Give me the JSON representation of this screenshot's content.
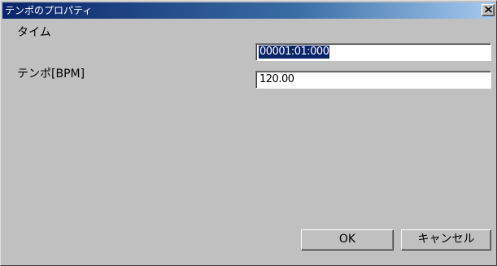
{
  "window": {
    "title": "テンポのプロパティ",
    "close_glyph": "×"
  },
  "fields": [
    {
      "label": "タイム",
      "value": "00001:01:000",
      "selected": true
    },
    {
      "label": "テンポ[BPM]",
      "value": "120.00",
      "selected": false
    }
  ],
  "buttons": {
    "ok_label": "OK",
    "cancel_label": "キャンセル"
  },
  "colors": {
    "titlebar_start": "#0a246a",
    "titlebar_end": "#a6caf0",
    "dialog_face": "#c0c0c0",
    "selection": "#0a246a"
  },
  "icons": [
    "close-icon"
  ]
}
